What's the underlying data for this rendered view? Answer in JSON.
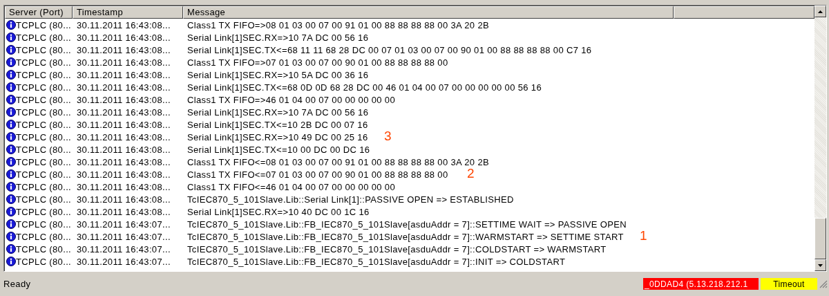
{
  "columns": [
    "Server (Port)",
    "Timestamp",
    "Message"
  ],
  "rows": [
    {
      "server": "TCPLC (80...",
      "timestamp": "30.11.2011 16:43:08...",
      "message": "Class1 TX FIFO=>08 01 03 00 07 00 91 01 00 88 88 88 88 00 3A 20 2B"
    },
    {
      "server": "TCPLC (80...",
      "timestamp": "30.11.2011 16:43:08...",
      "message": "Serial Link[1]SEC.RX=>10 7A DC 00 56 16"
    },
    {
      "server": "TCPLC (80...",
      "timestamp": "30.11.2011 16:43:08...",
      "message": "Serial Link[1]SEC.TX<=68 11 11 68 28 DC 00 07 01 03 00 07 00 90 01 00 88 88 88 88 00 C7 16"
    },
    {
      "server": "TCPLC (80...",
      "timestamp": "30.11.2011 16:43:08...",
      "message": "Class1 TX FIFO=>07 01 03 00 07 00 90 01 00 88 88 88 88 00"
    },
    {
      "server": "TCPLC (80...",
      "timestamp": "30.11.2011 16:43:08...",
      "message": "Serial Link[1]SEC.RX=>10 5A DC 00 36 16"
    },
    {
      "server": "TCPLC (80...",
      "timestamp": "30.11.2011 16:43:08...",
      "message": "Serial Link[1]SEC.TX<=68 0D 0D 68 28 DC 00 46 01 04 00 07 00 00 00 00 00 56 16"
    },
    {
      "server": "TCPLC (80...",
      "timestamp": "30.11.2011 16:43:08...",
      "message": "Class1 TX FIFO=>46 01 04 00 07 00 00 00 00 00"
    },
    {
      "server": "TCPLC (80...",
      "timestamp": "30.11.2011 16:43:08...",
      "message": "Serial Link[1]SEC.RX=>10 7A DC 00 56 16"
    },
    {
      "server": "TCPLC (80...",
      "timestamp": "30.11.2011 16:43:08...",
      "message": "Serial Link[1]SEC.TX<=10 2B DC 00 07 16"
    },
    {
      "server": "TCPLC (80...",
      "timestamp": "30.11.2011 16:43:08...",
      "message": "Serial Link[1]SEC.RX=>10 49 DC 00 25 16"
    },
    {
      "server": "TCPLC (80...",
      "timestamp": "30.11.2011 16:43:08...",
      "message": "Serial Link[1]SEC.TX<=10 00 DC 00 DC 16"
    },
    {
      "server": "TCPLC (80...",
      "timestamp": "30.11.2011 16:43:08...",
      "message": "Class1 TX FIFO<=08 01 03 00 07 00 91 01 00 88 88 88 88 00 3A 20 2B"
    },
    {
      "server": "TCPLC (80...",
      "timestamp": "30.11.2011 16:43:08...",
      "message": "Class1 TX FIFO<=07 01 03 00 07 00 90 01 00 88 88 88 88 00"
    },
    {
      "server": "TCPLC (80...",
      "timestamp": "30.11.2011 16:43:08...",
      "message": "Class1 TX FIFO<=46 01 04 00 07 00 00 00 00 00"
    },
    {
      "server": "TCPLC (80...",
      "timestamp": "30.11.2011 16:43:08...",
      "message": "TcIEC870_5_101Slave.Lib::Serial Link[1]::PASSIVE OPEN => ESTABLISHED"
    },
    {
      "server": "TCPLC (80...",
      "timestamp": "30.11.2011 16:43:08...",
      "message": "Serial Link[1]SEC.RX=>10 40 DC 00 1C 16"
    },
    {
      "server": "TCPLC (80...",
      "timestamp": "30.11.2011 16:43:07...",
      "message": "TcIEC870_5_101Slave.Lib::FB_IEC870_5_101Slave[asduAddr = 7]::SETTIME WAIT => PASSIVE OPEN"
    },
    {
      "server": "TCPLC (80...",
      "timestamp": "30.11.2011 16:43:07...",
      "message": "TcIEC870_5_101Slave.Lib::FB_IEC870_5_101Slave[asduAddr = 7]::WARMSTART => SETTIME START"
    },
    {
      "server": "TCPLC (80...",
      "timestamp": "30.11.2011 16:43:07...",
      "message": "TcIEC870_5_101Slave.Lib::FB_IEC870_5_101Slave[asduAddr = 7]::COLDSTART => WARMSTART"
    },
    {
      "server": "TCPLC (80...",
      "timestamp": "30.11.2011 16:43:07...",
      "message": "TcIEC870_5_101Slave.Lib::FB_IEC870_5_101Slave[asduAddr = 7]::INIT => COLDSTART"
    }
  ],
  "annotations": [
    "3",
    "2",
    "1"
  ],
  "status_bar": {
    "text": "Ready",
    "panels": [
      {
        "text": "_0DDAD4 (5.13.218.212.1",
        "color": "#ff0000"
      },
      {
        "text": "Timeout",
        "color": "#ffff00"
      }
    ]
  }
}
